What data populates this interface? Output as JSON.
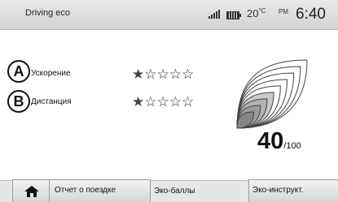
{
  "header": {
    "title": "Driving eco",
    "temperature": "20",
    "temperature_unit": "°C",
    "ampm": "PM",
    "time": "6:40",
    "icons": [
      "signal-icon",
      "battery-icon"
    ]
  },
  "criteria": [
    {
      "badge": "A",
      "label": "Ускорение",
      "stars_filled": 1,
      "stars_total": 5
    },
    {
      "badge": "B",
      "label": "Дистанция",
      "stars_filled": 1,
      "stars_total": 5
    }
  ],
  "score": {
    "value": "40",
    "total": "/100",
    "level": 0.4
  },
  "tabs": {
    "home_icon": "home-icon",
    "trip_report": "Отчет о поездке",
    "eco_points": "Эко-баллы",
    "eco_instructions": "Эко-инструкт."
  }
}
